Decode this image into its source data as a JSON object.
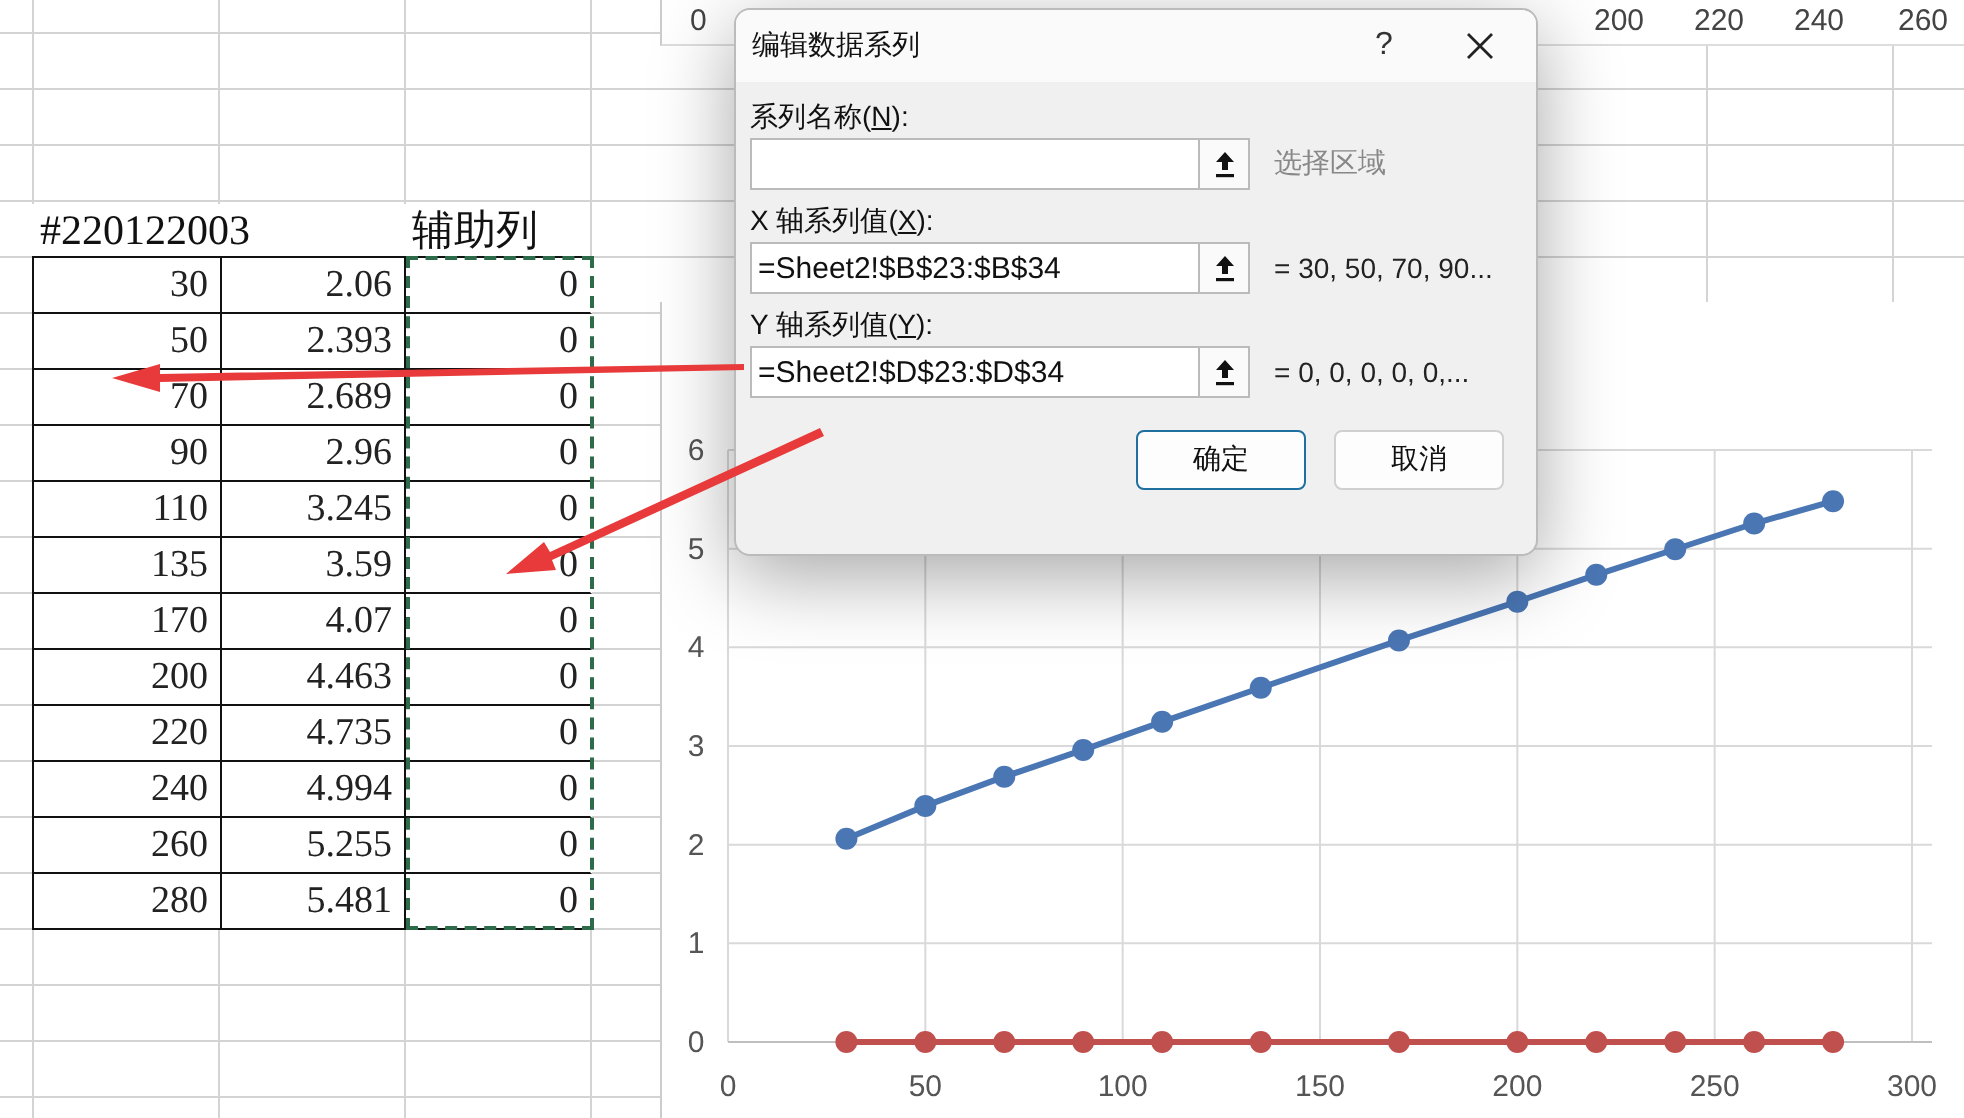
{
  "top_chart": {
    "axis_labels": [
      "0",
      "200",
      "220",
      "240",
      "260"
    ]
  },
  "table": {
    "title": "#220122003",
    "helper_column": {
      "label": "辅助列",
      "copied": true
    },
    "rows": [
      [
        "30",
        "2.06",
        "0"
      ],
      [
        "50",
        "2.393",
        "0"
      ],
      [
        "70",
        "2.689",
        "0"
      ],
      [
        "90",
        "2.96",
        "0"
      ],
      [
        "110",
        "3.245",
        "0"
      ],
      [
        "135",
        "3.59",
        "0"
      ],
      [
        "170",
        "4.07",
        "0"
      ],
      [
        "200",
        "4.463",
        "0"
      ],
      [
        "220",
        "4.735",
        "0"
      ],
      [
        "240",
        "4.994",
        "0"
      ],
      [
        "260",
        "5.255",
        "0"
      ],
      [
        "280",
        "5.481",
        "0"
      ]
    ]
  },
  "dialog": {
    "title": "编辑数据系列",
    "help": "?",
    "fields": [
      {
        "label_parts": [
          "系列名称(",
          "N",
          "):"
        ],
        "hint": "选择区域",
        "kind": "hint"
      },
      {
        "label_parts": [
          "X 轴系列值(",
          "X",
          "):"
        ],
        "value": "=Sheet2!$B$23:$B$34",
        "preview": "= 30, 50, 70, 90...",
        "kind": "preview"
      },
      {
        "label_parts": [
          "Y 轴系列值(",
          "Y",
          "):"
        ],
        "value": "=Sheet2!$D$23:$D$34",
        "preview": "= 0, 0, 0, 0, 0,...",
        "kind": "preview"
      }
    ],
    "buttons": [
      {
        "label": "确定",
        "default": true
      },
      {
        "label": "取消",
        "default": false
      }
    ]
  },
  "chart": {
    "chart_data": {
      "type": "line",
      "x": [
        30,
        50,
        70,
        90,
        110,
        135,
        170,
        200,
        220,
        240,
        260,
        280
      ],
      "grid": true,
      "series": [
        {
          "color": "#4a76b4",
          "marker": "circle",
          "values": [
            2.06,
            2.393,
            2.689,
            2.96,
            3.245,
            3.59,
            4.07,
            4.463,
            4.735,
            4.994,
            5.255,
            5.481
          ]
        },
        {
          "color": "#c0504d",
          "marker": "circle",
          "values": [
            0,
            0,
            0,
            0,
            0,
            0,
            0,
            0,
            0,
            0,
            0,
            0
          ]
        }
      ],
      "xlim": [
        0,
        300
      ],
      "ylim": [
        0,
        6
      ],
      "xticks": [
        0,
        50,
        100,
        150,
        200,
        250,
        300
      ],
      "yticks": [
        0,
        1,
        2,
        3,
        4,
        5,
        6
      ]
    }
  }
}
